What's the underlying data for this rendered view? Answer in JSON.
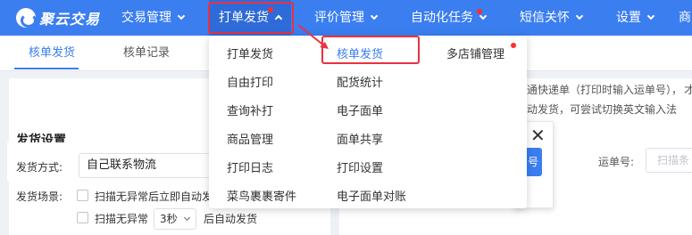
{
  "brand": {
    "name": "聚云交易"
  },
  "nav": {
    "items": [
      {
        "label": "交易管理"
      },
      {
        "label": "打单发货"
      },
      {
        "label": "评价管理"
      },
      {
        "label": "自动化任务"
      },
      {
        "label": "短信关怀"
      },
      {
        "label": "设置"
      },
      {
        "label": "商"
      }
    ]
  },
  "subtabs": {
    "items": [
      {
        "label": "核单发货"
      },
      {
        "label": "核单记录"
      }
    ]
  },
  "dropdown": {
    "col1": [
      {
        "label": "打单发货"
      },
      {
        "label": "自由打印"
      },
      {
        "label": "查询补打"
      },
      {
        "label": "商品管理"
      },
      {
        "label": "打印日志"
      },
      {
        "label": "菜鸟裹裹寄件"
      }
    ],
    "col2": [
      {
        "label": "核单发货"
      },
      {
        "label": "配货统计"
      },
      {
        "label": "电子面单"
      },
      {
        "label": "面单共享"
      },
      {
        "label": "打印设置"
      },
      {
        "label": "电子面单对账"
      }
    ],
    "col3": [
      {
        "label": "多店铺管理"
      }
    ]
  },
  "settings": {
    "section_title": "发货设置",
    "ship_method_label": "发货方式:",
    "ship_method_value": "自己联系物流",
    "scene_label": "发货场景:",
    "opt1_label": "扫描无异常后立即自动发",
    "opt2_prefix": "扫描无异常",
    "opt2_delay": "3秒",
    "opt2_suffix": "后自动发货"
  },
  "hints": {
    "line1": "通快递单（打印时输入运单号），",
    "line1_tail": "才",
    "line2": "动发货，可尝试切换英文输入法"
  },
  "modal": {
    "close": "✕",
    "button_tail": "号"
  },
  "waybill": {
    "label": "运单号:",
    "placeholder": "扫描条"
  },
  "colors": {
    "accent": "#3a7ef0",
    "highlight": "#e8333f",
    "dot": "#ff2d2d"
  }
}
